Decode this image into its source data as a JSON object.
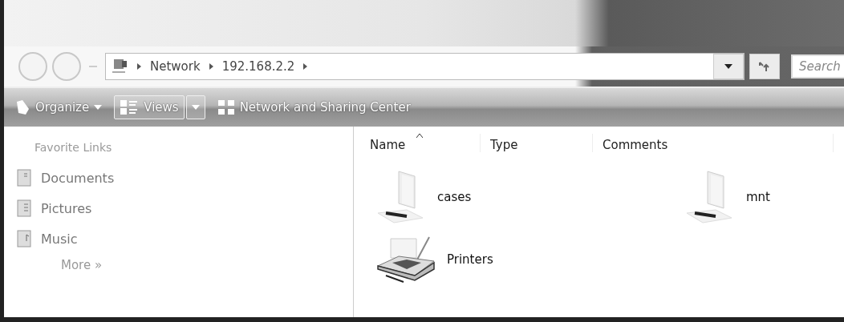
{
  "address_bar": {
    "breadcrumbs": [
      "Network",
      "192.168.2.2"
    ]
  },
  "search": {
    "placeholder": "Search"
  },
  "toolbar": {
    "items": [
      {
        "kind": "menu",
        "label": "Organize"
      },
      {
        "kind": "split",
        "label": "Views"
      },
      {
        "kind": "link",
        "label": "Network and Sharing Center"
      }
    ]
  },
  "sidebar": {
    "title": "Favorite Links",
    "items": [
      {
        "kind": "documents",
        "label": "Documents"
      },
      {
        "kind": "pictures",
        "label": "Pictures"
      },
      {
        "kind": "music",
        "label": "Music"
      }
    ],
    "more": "More »"
  },
  "columns": [
    {
      "label": "Name",
      "sorted": true
    },
    {
      "label": "Type",
      "sorted": false
    },
    {
      "label": "Comments",
      "sorted": false
    }
  ],
  "items": [
    {
      "kind": "share",
      "label": "cases"
    },
    {
      "kind": "share",
      "label": "mnt"
    },
    {
      "kind": "printer",
      "label": "Printers"
    }
  ]
}
